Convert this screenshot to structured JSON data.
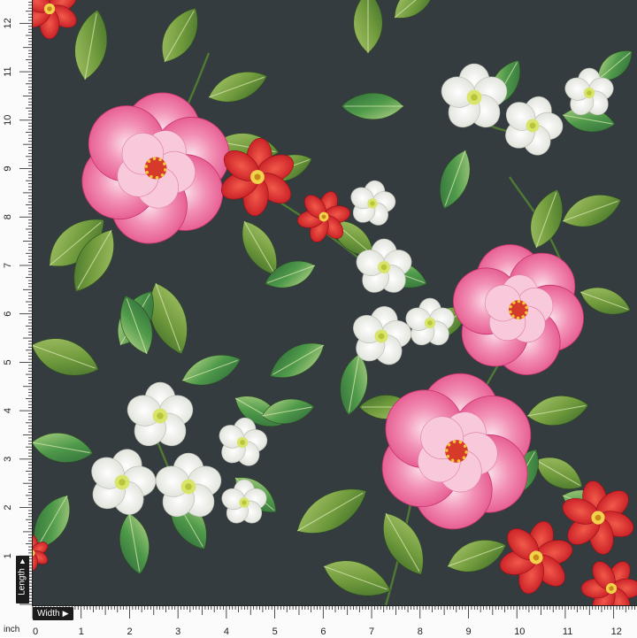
{
  "rulers": {
    "unit_label": "inch",
    "width_tag": "Width",
    "length_tag": "Length",
    "bottom_numbers": [
      "0",
      "1",
      "2",
      "3",
      "4",
      "5",
      "6",
      "7",
      "8",
      "9",
      "10",
      "11",
      "12"
    ],
    "left_numbers": [
      "12",
      "11",
      "10",
      "9",
      "8",
      "7",
      "6",
      "5",
      "4",
      "3",
      "2",
      "1"
    ]
  },
  "fabric": {
    "background_color": "#353c40",
    "leaf_color": "#6f9a3c",
    "pink_color": "#e8508a",
    "red_color": "#d8202a",
    "white_color": "#f4f4ee"
  }
}
